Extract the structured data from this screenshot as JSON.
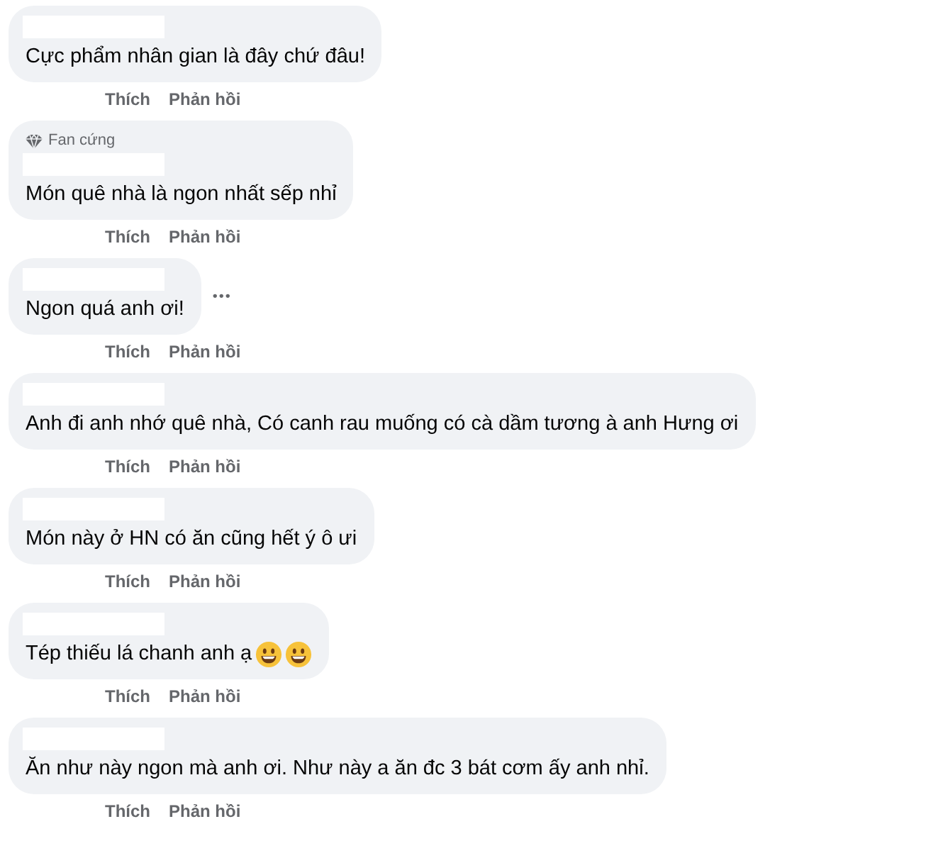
{
  "comments": [
    {
      "text": "Cực phẩm nhân gian là đây chứ đâu!",
      "actions": [
        "Thích",
        "Phản hồi"
      ]
    },
    {
      "badge": "Fan cứng",
      "text": "Món quê nhà là ngon nhất sếp nhỉ",
      "actions": [
        "Thích",
        "Phản hồi"
      ]
    },
    {
      "text": "Ngon quá anh ơi!",
      "more": "•••",
      "actions": [
        "Thích",
        "Phản hồi"
      ]
    },
    {
      "text": "Anh đi anh nhớ quê nhà, Có canh rau muống có cà dầm tương à anh Hưng ơi",
      "actions": [
        "Thích",
        "Phản hồi"
      ]
    },
    {
      "text": "Món này ở HN có ăn cũng hết ý ô ưi",
      "actions": [
        "Thích",
        "Phản hồi"
      ]
    },
    {
      "text": "Tép thiếu lá chanh anh ạ",
      "emojis": [
        {
          "kind": "smile"
        },
        {
          "kind": "smile"
        }
      ],
      "actions": [
        "Thích",
        "Phản hồi"
      ]
    },
    {
      "text": "Ăn như này ngon mà anh ơi. Như này a ăn đc 3 bát cơm ấy anh nhỉ.",
      "actions": [
        "Thích",
        "Phản hồi"
      ]
    }
  ]
}
